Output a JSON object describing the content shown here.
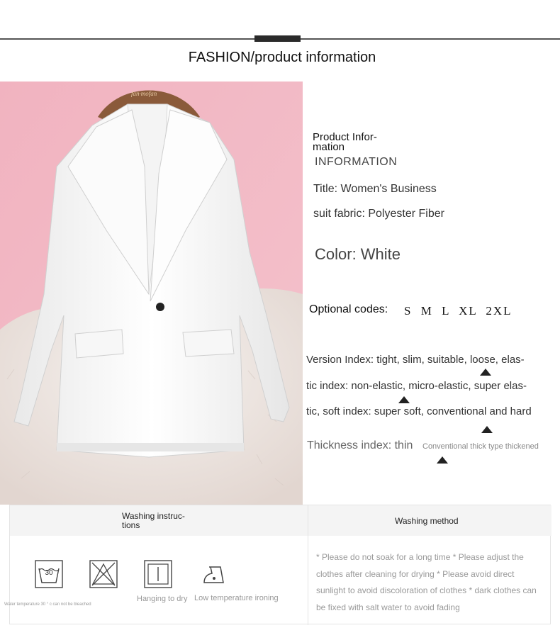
{
  "header": {
    "title": "FASHION/product information"
  },
  "photo": {
    "hanger_brand": "fan·mofan"
  },
  "info": {
    "section_title": "Product Infor- mation",
    "section_subtitle": "INFORMATION",
    "title_line": "Title: Women's Business",
    "fabric_line": "suit fabric: Polyester Fiber",
    "color_line": "Color: White",
    "sizes_label": "Optional codes:",
    "sizes": "S M L XL 2XL",
    "version_index": "Version Index: tight, slim, suitable, loose, elas-",
    "elastic_index": "tic index: non-elastic, micro-elastic, super elas-",
    "soft_index": "tic, soft index: super soft, conventional and hard",
    "thickness_label": "Thickness index: thin",
    "thickness_options": "Conventional thick type thickened",
    "selected": {
      "version": "loose",
      "elasticity": "micro-elastic",
      "softness": "conventional",
      "thickness": "Conventional"
    }
  },
  "washing": {
    "instructions_title": "Washing instruc- tions",
    "method_title": "Washing method",
    "icons": [
      {
        "icon": "wash-tub-30-icon",
        "text": "30",
        "label": ""
      },
      {
        "icon": "no-bleach-icon",
        "label": ""
      },
      {
        "icon": "hang-dry-icon",
        "label": "Hanging to dry"
      },
      {
        "icon": "low-iron-icon",
        "label": "Low temperature ironing"
      }
    ],
    "tiny_note": "Water temperature 30 ° c can not be bleached",
    "method_text": "* Please do not soak for a long time * Please adjust the clothes after cleaning for drying * Please avoid direct sunlight to avoid discoloration of clothes * dark clothes can be fixed with salt water to avoid fading"
  },
  "colors": {
    "photo_background": "#f0b4c0",
    "jacket": "#fafafa",
    "hanger": "#8a5a3a",
    "rug": "#f2ece8"
  }
}
